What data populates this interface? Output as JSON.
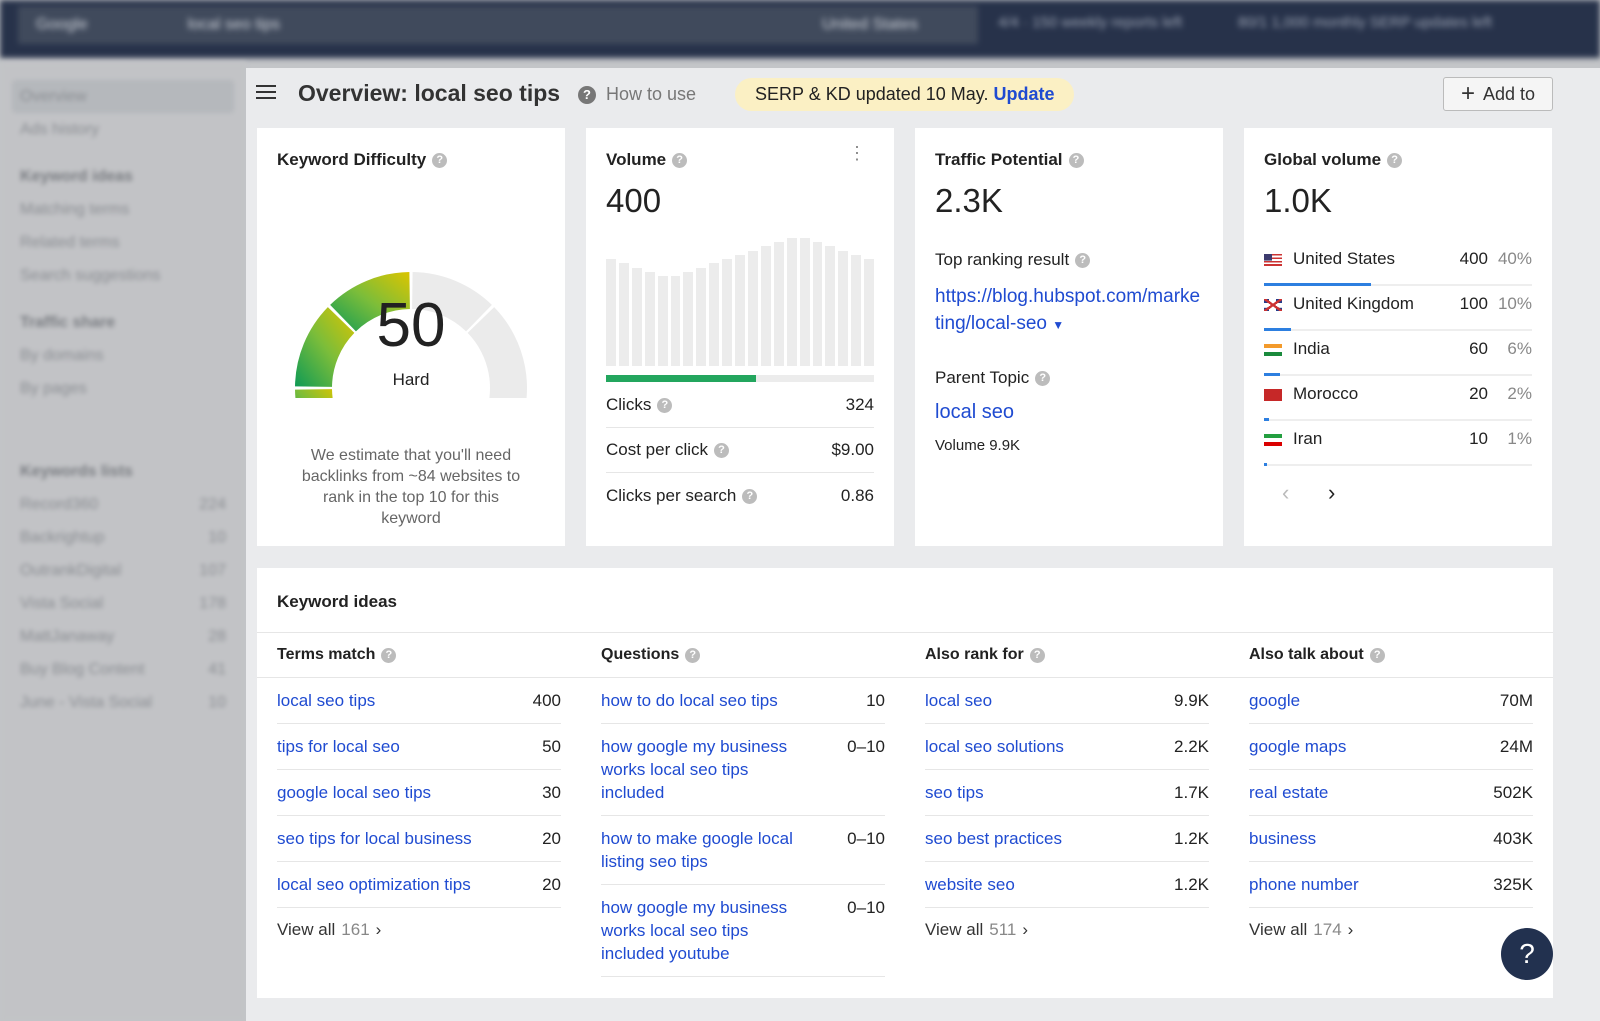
{
  "topbar": {
    "engine": "Google",
    "query": "local seo tips",
    "country": "United States",
    "quota1": "4/4 · 150 weekly reports left",
    "quota2": "80/1 1,000 monthly SERP updates left"
  },
  "sidebar": {
    "items": [
      "Overview",
      "Ads history"
    ],
    "sections": [
      {
        "title": "Keyword ideas",
        "items": [
          "Matching terms",
          "Related terms",
          "Search suggestions"
        ]
      },
      {
        "title": "Traffic share",
        "items": [
          "By domains",
          "By pages"
        ]
      }
    ],
    "lists_title": "Keywords lists",
    "lists": [
      {
        "name": "Record360",
        "count": "224"
      },
      {
        "name": "Backrightup",
        "count": "10"
      },
      {
        "name": "OutrankDigital",
        "count": "107"
      },
      {
        "name": "Vista Social",
        "count": "178"
      },
      {
        "name": "MattJanaway",
        "count": "28"
      },
      {
        "name": "Buy Blog Content",
        "count": "41"
      },
      {
        "name": "June - Vista Social",
        "count": "10"
      }
    ]
  },
  "header": {
    "title": "Overview: local seo tips",
    "how_to_use": "How to use",
    "serp_notice": "SERP & KD updated 10 May.",
    "update_link": "Update",
    "add_to": "Add to"
  },
  "kd": {
    "title": "Keyword Difficulty",
    "value": "50",
    "label": "Hard",
    "score": 50,
    "note": "We estimate that you'll need backlinks from ~84 websites to rank in the top 10 for this keyword"
  },
  "volume": {
    "title": "Volume",
    "value": "400",
    "trend": [
      304,
      292,
      280,
      268,
      256,
      256,
      268,
      280,
      292,
      304,
      316,
      328,
      340,
      352,
      364,
      364,
      352,
      340,
      328,
      316,
      304
    ],
    "clicks_fill_pct": 56,
    "rows": [
      {
        "label": "Clicks",
        "value": "324"
      },
      {
        "label": "Cost per click",
        "value": "$9.00"
      },
      {
        "label": "Clicks per search",
        "value": "0.86"
      }
    ]
  },
  "traffic": {
    "title": "Traffic Potential",
    "value": "2.3K",
    "top_label": "Top ranking result",
    "top_url": "https://blog.hubspot.com/marketing/local-seo",
    "parent_label": "Parent Topic",
    "parent": "local seo",
    "parent_volume": "Volume 9.9K"
  },
  "global": {
    "title": "Global volume",
    "value": "1.0K",
    "countries": [
      {
        "name": "United States",
        "volume": "400",
        "pct": "40%",
        "share": 40,
        "flag": "us"
      },
      {
        "name": "United Kingdom",
        "volume": "100",
        "pct": "10%",
        "share": 10,
        "flag": "gb"
      },
      {
        "name": "India",
        "volume": "60",
        "pct": "6%",
        "share": 6,
        "flag": "in"
      },
      {
        "name": "Morocco",
        "volume": "20",
        "pct": "2%",
        "share": 2,
        "flag": "ma"
      },
      {
        "name": "Iran",
        "volume": "10",
        "pct": "1%",
        "share": 1,
        "flag": "ir"
      }
    ]
  },
  "ideas": {
    "title": "Keyword ideas",
    "columns": [
      {
        "title": "Terms match",
        "rows": [
          [
            "local seo tips",
            "400"
          ],
          [
            "tips for local seo",
            "50"
          ],
          [
            "google local seo tips",
            "30"
          ],
          [
            "seo tips for local business",
            "20"
          ],
          [
            "local seo optimization tips",
            "20"
          ]
        ],
        "view_all": "View all",
        "count": "161"
      },
      {
        "title": "Questions",
        "rows": [
          [
            "how to do local seo tips",
            "10"
          ],
          [
            "how google my business works local seo tips included",
            "0–10"
          ],
          [
            "how to make google local listing seo tips",
            "0–10"
          ],
          [
            "how google my business works local seo tips included youtube",
            "0–10"
          ]
        ]
      },
      {
        "title": "Also rank for",
        "rows": [
          [
            "local seo",
            "9.9K"
          ],
          [
            "local seo solutions",
            "2.2K"
          ],
          [
            "seo tips",
            "1.7K"
          ],
          [
            "seo best practices",
            "1.2K"
          ],
          [
            "website seo",
            "1.2K"
          ]
        ],
        "view_all": "View all",
        "count": "511"
      },
      {
        "title": "Also talk about",
        "rows": [
          [
            "google",
            "70M"
          ],
          [
            "google maps",
            "24M"
          ],
          [
            "real estate",
            "502K"
          ],
          [
            "business",
            "403K"
          ],
          [
            "phone number",
            "325K"
          ]
        ],
        "view_all": "View all",
        "count": "174"
      }
    ]
  },
  "help": "?"
}
